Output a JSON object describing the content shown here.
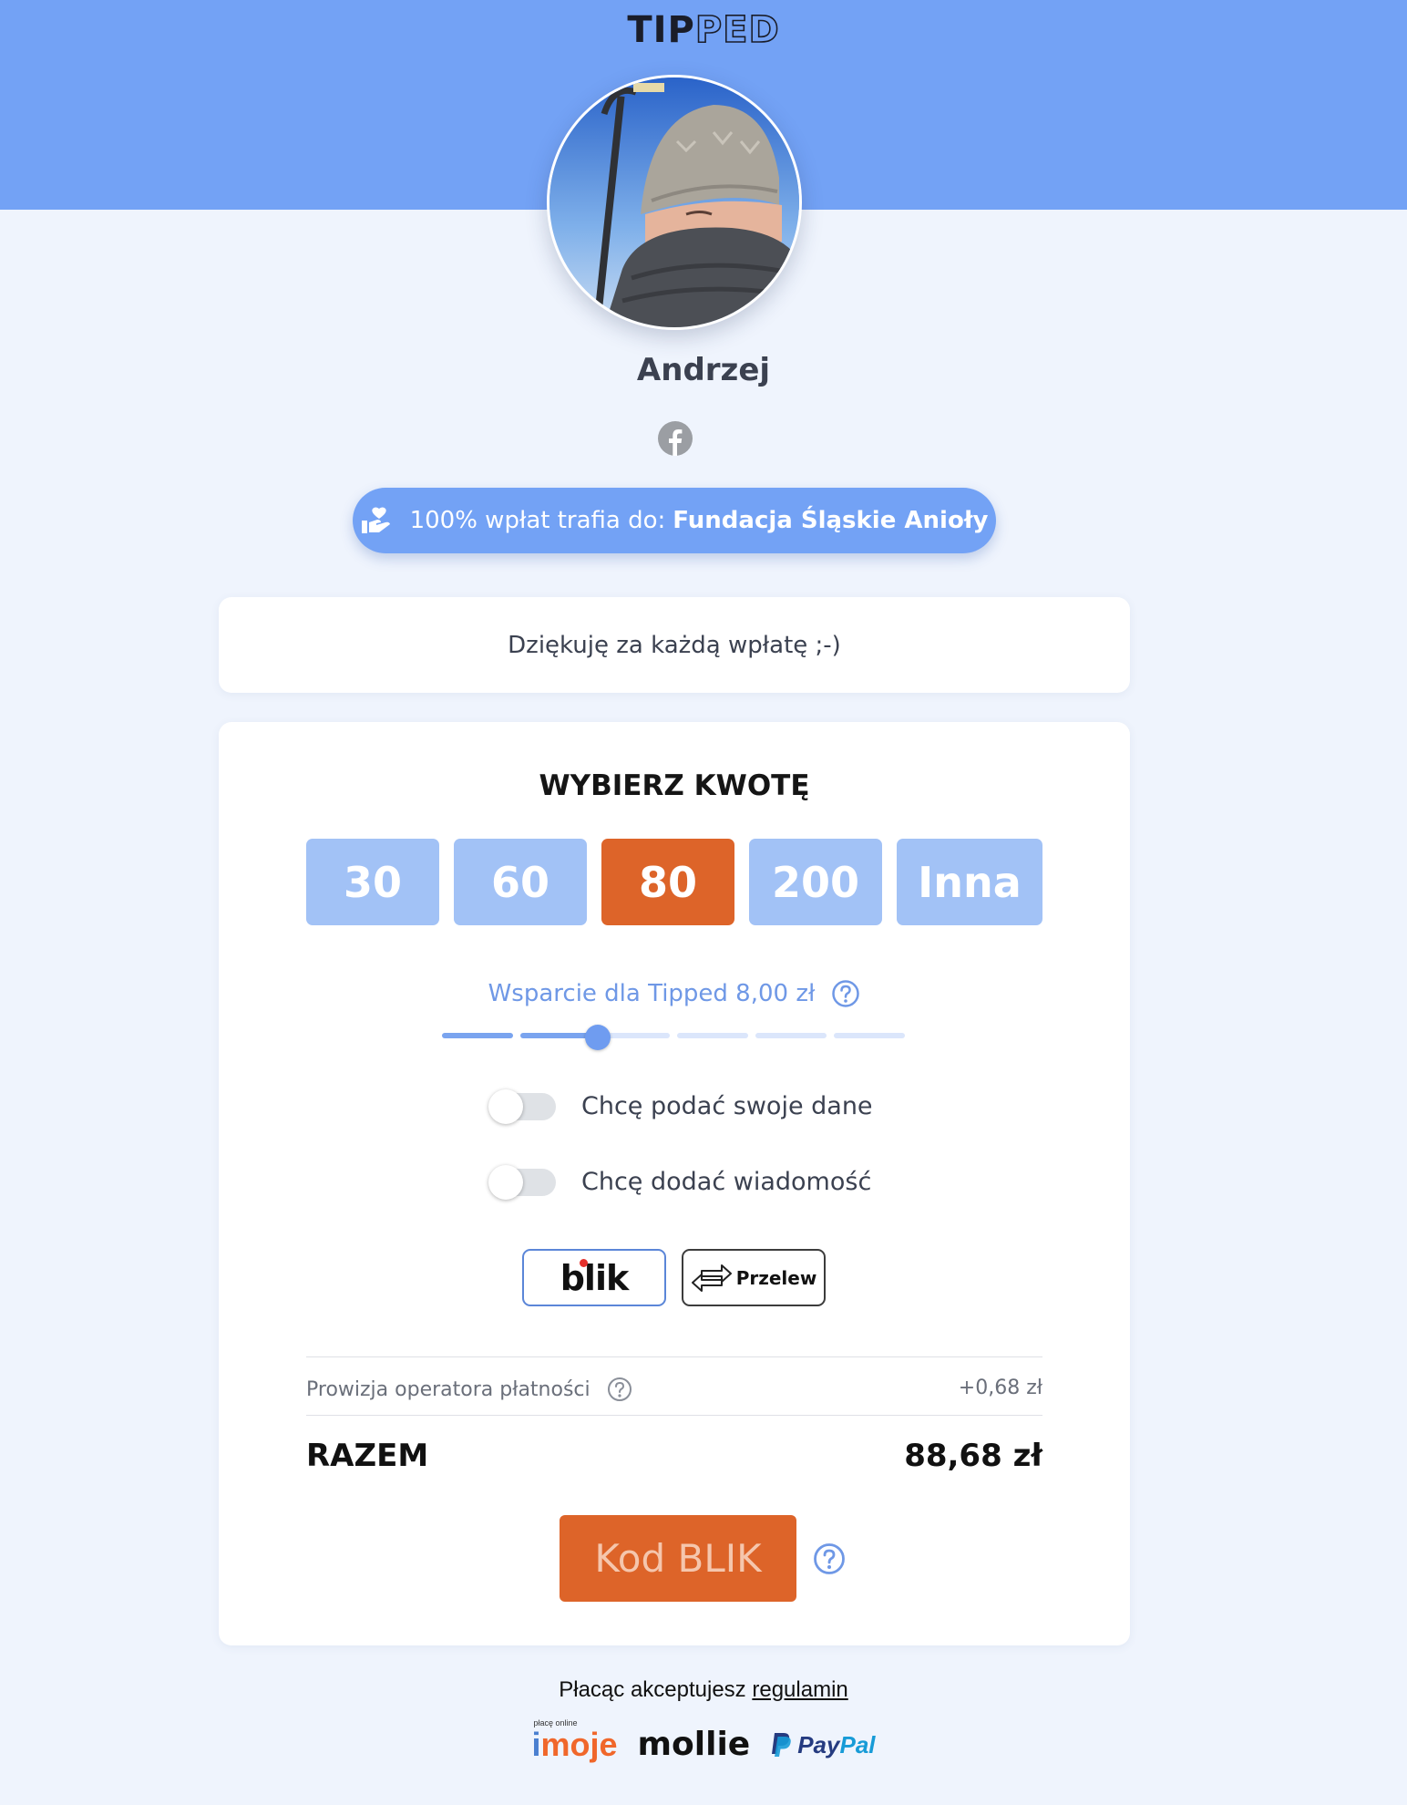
{
  "brand": {
    "logo_bold": "TIP",
    "logo_outline": "PED"
  },
  "profile": {
    "name": "Andrzej",
    "social": "facebook-icon"
  },
  "charity": {
    "prefix": "100% wpłat trafia do:",
    "organization": "Fundacja Śląskie Anioły"
  },
  "message": "Dziękuję za każdą wpłatę ;-)",
  "amount_picker": {
    "title": "WYBIERZ KWOTĘ",
    "options": [
      "30",
      "60",
      "80",
      "200",
      "Inna"
    ],
    "selected": "80"
  },
  "support": {
    "label": "Wsparcie dla Tipped 8,00 zł",
    "level": 0.3
  },
  "toggles": [
    {
      "label": "Chcę podać swoje dane",
      "on": false
    },
    {
      "label": "Chcę dodać wiadomość",
      "on": false
    }
  ],
  "payment_methods": [
    {
      "label": "blik",
      "selected": true
    },
    {
      "label": "Przelew",
      "selected": false
    }
  ],
  "summary": {
    "fee_label": "Prowizja operatora płatności",
    "fee_value": "+0,68 zł",
    "total_label": "RAZEM",
    "total_value": "88,68 zł"
  },
  "cta": {
    "label": "Kod BLIK"
  },
  "terms": {
    "text": "Płacąc akceptujesz",
    "link": "regulamin"
  },
  "providers": {
    "imoje_tagline": "płacę online",
    "imoje_i": "i",
    "imoje_rest": "moje",
    "mollie": "mollie",
    "paypal_pay": "Pay",
    "paypal_pal": "Pal"
  },
  "colors": {
    "header": "#73a2f5",
    "accent": "#dd6429",
    "amount_button": "#a2c2f6",
    "background": "#eff4fd"
  }
}
